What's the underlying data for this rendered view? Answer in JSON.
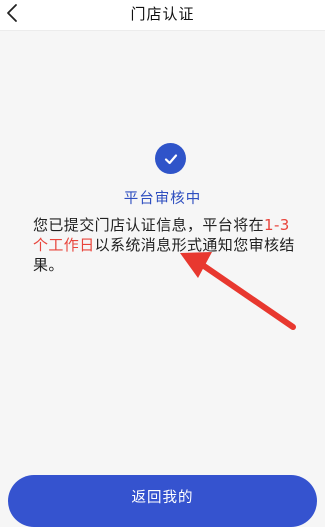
{
  "header": {
    "title": "门店认证",
    "back_icon": "chevron-left-icon"
  },
  "status": {
    "icon": "check-circle-icon",
    "title": "平台审核中",
    "desc_before": "您已提交门店认证信息，平台将在",
    "desc_highlight": "1-3个工作日",
    "desc_after": "以系统消息形式通知您审核结果。"
  },
  "annotation": {
    "arrow_color": "#e8382f"
  },
  "footer": {
    "return_label": "返回我的"
  },
  "colors": {
    "accent": "#2f54c9",
    "highlight": "#e8453c",
    "background": "#f6f6f6"
  }
}
